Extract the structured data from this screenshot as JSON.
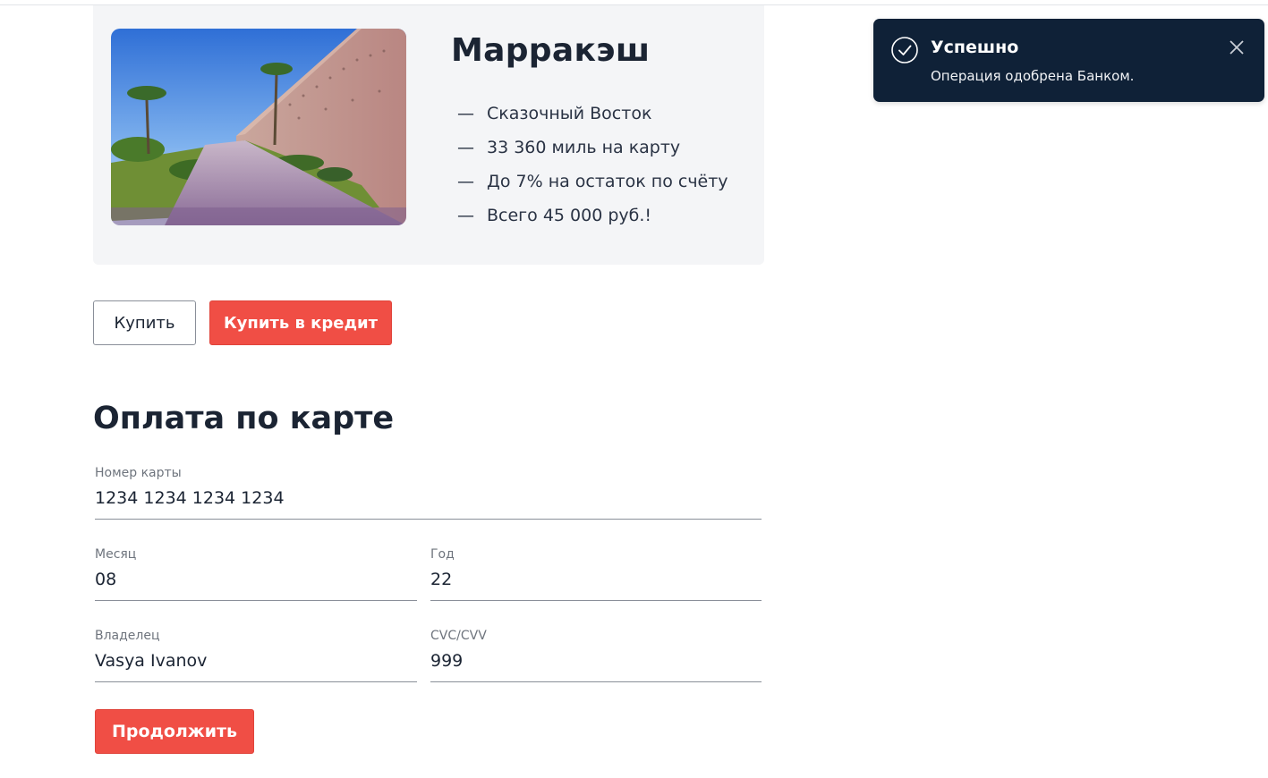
{
  "offer": {
    "title": "Марракэш",
    "features": [
      "Сказочный Восток",
      "33 360 миль на карту",
      "До 7% на остаток по счёту",
      "Всего 45 000 руб.!"
    ],
    "dash": "—"
  },
  "actions": {
    "buy_label": "Купить",
    "credit_label": "Купить в кредит"
  },
  "payment": {
    "title": "Оплата по карте",
    "card_number": {
      "label": "Номер карты",
      "value": "1234 1234 1234 1234"
    },
    "month": {
      "label": "Месяц",
      "value": "08"
    },
    "year": {
      "label": "Год",
      "value": "22"
    },
    "owner": {
      "label": "Владелец",
      "value": "Vasya Ivanov"
    },
    "cvc": {
      "label": "CVC/CVV",
      "value": "999"
    },
    "continue_label": "Продолжить"
  },
  "notification": {
    "title": "Успешно",
    "message": "Операция одобрена Банком.",
    "icon": "check-circle-icon",
    "close_icon": "close-icon"
  },
  "colors": {
    "accent": "#f04e45",
    "toast_bg": "#0f2137",
    "card_bg": "#f4f5f7",
    "text": "#1b2433"
  }
}
